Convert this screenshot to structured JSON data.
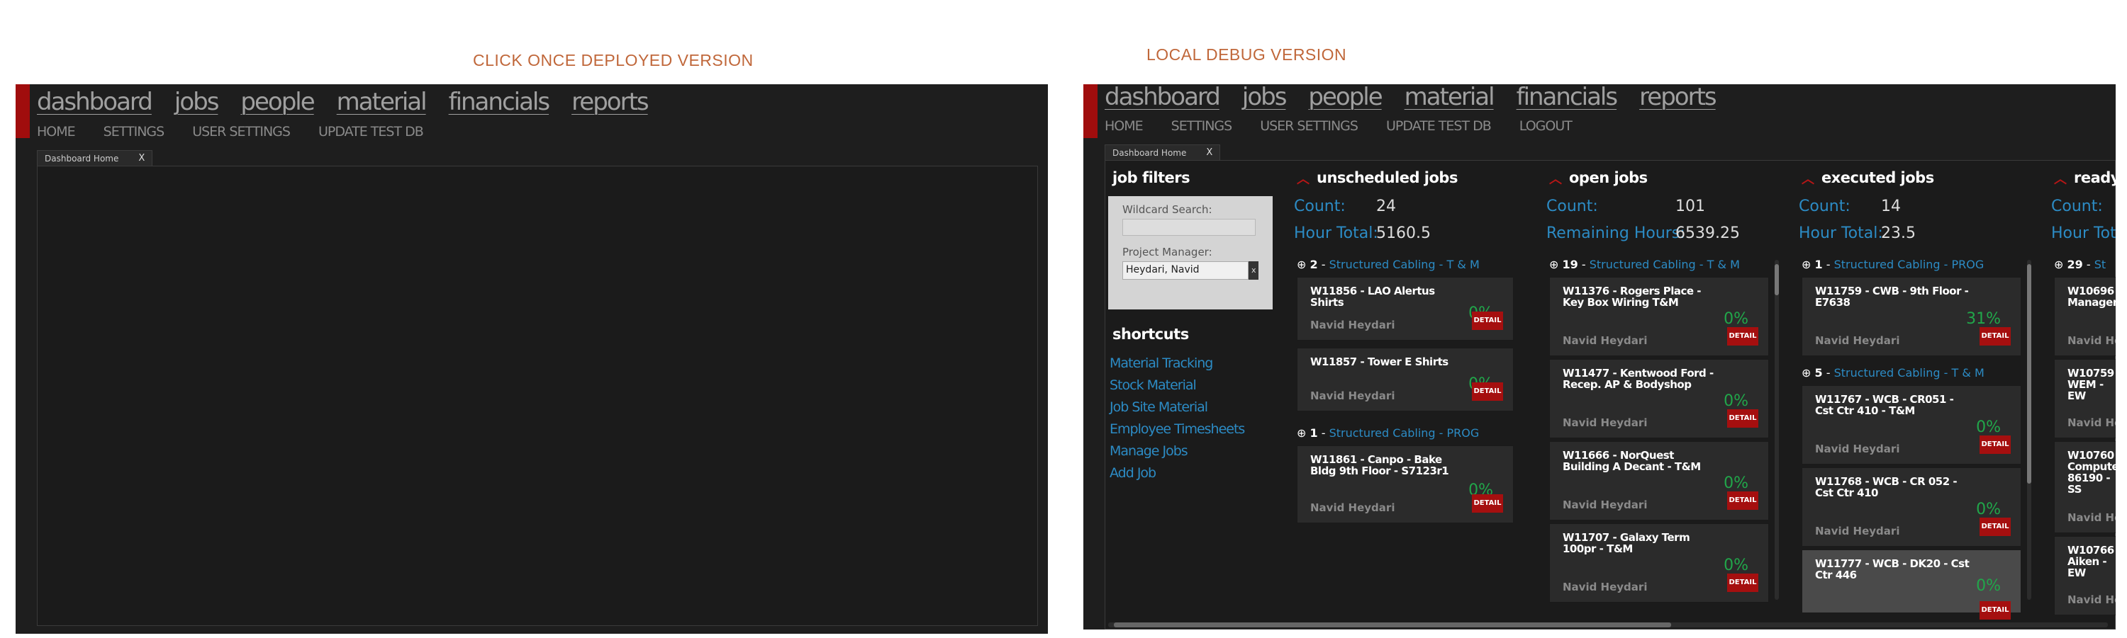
{
  "captions": {
    "left": "CLICK ONCE DEPLOYED VERSION",
    "right": "LOCAL DEBUG VERSION"
  },
  "nav": {
    "main": [
      "dashboard",
      "jobs",
      "people",
      "material",
      "financials",
      "reports"
    ],
    "sub_left": [
      "HOME",
      "SETTINGS",
      "USER SETTINGS",
      "UPDATE TEST DB"
    ],
    "sub_right": [
      "HOME",
      "SETTINGS",
      "USER SETTINGS",
      "UPDATE TEST DB",
      "LOGOUT"
    ]
  },
  "tab": {
    "label": "Dashboard Home",
    "close": "X"
  },
  "filters": {
    "title": "job filters",
    "wildcard_label": "Wildcard Search:",
    "wildcard_value": "",
    "pm_label": "Project Manager:",
    "pm_value": "Heydari, Navid",
    "pm_button": "x"
  },
  "shortcuts": {
    "title": "shortcuts",
    "items": [
      "Material Tracking",
      "Stock Material",
      "Job Site Material",
      "Employee Timesheets",
      "Manage Jobs",
      "Add Job"
    ]
  },
  "detail_label": "DETAIL",
  "columns": [
    {
      "title": "unscheduled jobs",
      "stat1_label": "Count:",
      "stat1_value": "24",
      "stat2_label": "Hour Total:",
      "stat2_value": "5160.5",
      "groups": [
        {
          "count": "2",
          "name": "Structured Cabling  - T & M",
          "cards": [
            {
              "title": "W11856 - LAO Alertus Shirts",
              "pct": "0%",
              "pm": "Navid Heydari"
            },
            {
              "title": "W11857 - Tower E Shirts",
              "pct": "0%",
              "pm": "Navid Heydari"
            }
          ]
        },
        {
          "count": "1",
          "name": "Structured Cabling  - PROG",
          "cards": [
            {
              "title": "W11861 - Canpo - Bake Bldg 9th Floor - S7123r1",
              "pct": "0%",
              "pm": "Navid Heydari"
            }
          ]
        }
      ]
    },
    {
      "title": "open jobs",
      "stat1_label": "Count:",
      "stat1_value": "101",
      "stat2_label": "Remaining Hours:",
      "stat2_value": "6539.25",
      "groups": [
        {
          "count": "19",
          "name": "Structured Cabling  - T & M",
          "cards": [
            {
              "title": "W11376 - Rogers Place - Key Box Wiring T&M",
              "pct": "0%",
              "pm": "Navid Heydari"
            },
            {
              "title": "W11477 - Kentwood Ford - Recep. AP & Bodyshop",
              "pct": "0%",
              "pm": "Navid Heydari"
            },
            {
              "title": "W11666 - NorQuest Building A Decant - T&M",
              "pct": "0%",
              "pm": "Navid Heydari"
            },
            {
              "title": "W11707 - Galaxy Term 100pr - T&M",
              "pct": "0%",
              "pm": "Navid Heydari"
            }
          ]
        }
      ]
    },
    {
      "title": "executed jobs",
      "stat1_label": "Count:",
      "stat1_value": "14",
      "stat2_label": "Hour Total:",
      "stat2_value": "23.5",
      "groups": [
        {
          "count": "1",
          "name": "Structured Cabling  - PROG",
          "cards": [
            {
              "title": "W11759 - CWB - 9th Floor - E7638",
              "pct": "31%",
              "pm": "Navid Heydari"
            }
          ]
        },
        {
          "count": "5",
          "name": "Structured Cabling  - T & M",
          "cards": [
            {
              "title": "W11767 - WCB - CR051 - Cst Ctr 410 - T&M",
              "pct": "0%",
              "pm": "Navid Heydari"
            },
            {
              "title": "W11768 - WCB - CR 052 - Cst Ctr 410",
              "pct": "0%",
              "pm": "Navid Heydari"
            },
            {
              "title": "W11777 - WCB - DK20 - Cst Ctr 446",
              "pct": "0%",
              "pm": ""
            }
          ]
        }
      ]
    },
    {
      "title": "ready",
      "stat1_label": "Count:",
      "stat1_value": "",
      "stat2_label": "Hour Tot",
      "stat2_value": "",
      "groups": [
        {
          "count": "29",
          "name": "St",
          "cards": [
            {
              "title": "W10696 - Managem",
              "pct": "",
              "pm": "Navid He"
            },
            {
              "title": "W10759 - WEM - EW",
              "pct": "",
              "pm": "Navid He"
            },
            {
              "title": "W10760 - Computer 86190 - SS",
              "pct": "",
              "pm": "Navid He"
            },
            {
              "title": "W10766 - Aiken - EW",
              "pct": "",
              "pm": "Navid He"
            }
          ]
        }
      ]
    }
  ]
}
